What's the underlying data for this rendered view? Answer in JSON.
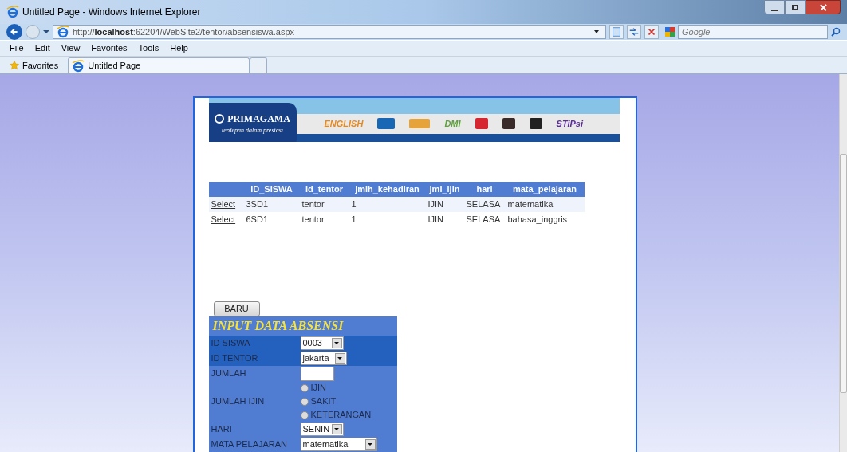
{
  "window": {
    "title": "Untitled Page - Windows Internet Explorer"
  },
  "address_bar": {
    "prefix": "http://",
    "host": "localhost",
    "rest": ":62204/WebSite2/tentor/absensiswa.aspx"
  },
  "search": {
    "placeholder": "Google"
  },
  "menu": [
    "File",
    "Edit",
    "View",
    "Favorites",
    "Tools",
    "Help"
  ],
  "favorites_bar": {
    "favorites": "Favorites",
    "tabs": [
      {
        "label": "Untitled Page",
        "selected": true
      }
    ]
  },
  "banner": {
    "brand": "PRIMAGAMA",
    "tagline": "terdepan dalam prestasi",
    "partners": [
      "ENGLISH",
      "DMI",
      "STiPsi"
    ]
  },
  "table": {
    "columns": [
      "",
      "ID_SISWA",
      "id_tentor",
      "jmlh_kehadiran",
      "jml_ijin",
      "hari",
      "mata_pelajaran"
    ],
    "rows": [
      {
        "cells": [
          "Select",
          "3SD1",
          "tentor",
          "1",
          "IJIN",
          "SELASA",
          "matematika"
        ]
      },
      {
        "cells": [
          "Select",
          "6SD1",
          "tentor",
          "1",
          "IJIN",
          "SELASA",
          "bahasa_inggris"
        ]
      }
    ]
  },
  "new_button": "BARU",
  "form": {
    "title": "INPUT DATA ABSENSI",
    "fields": [
      {
        "kind": "select",
        "label": "ID SISWA",
        "value": "0003",
        "highlighted": true
      },
      {
        "kind": "select",
        "label": "ID TENTOR",
        "value": "jakarta",
        "highlighted": true
      },
      {
        "kind": "text",
        "label": "JUMLAH",
        "highlighted": false
      },
      {
        "kind": "radio",
        "label": "JUMLAH IJIN",
        "highlighted": false,
        "options": [
          {
            "label": "IJIN",
            "selected": false
          },
          {
            "label": "SAKIT",
            "selected": false
          },
          {
            "label": "KETERANGAN",
            "selected": false
          }
        ]
      },
      {
        "kind": "select",
        "label": "HARI",
        "value": "SENIN",
        "highlighted": false
      },
      {
        "kind": "select",
        "label": "MATA PELAJARAN",
        "value": "matematika",
        "highlighted": false
      }
    ]
  }
}
